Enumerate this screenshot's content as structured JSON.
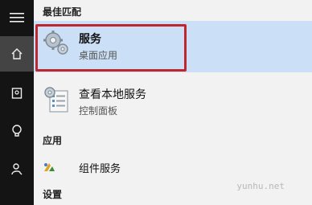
{
  "sections": {
    "best_match": "最佳匹配",
    "apps": "应用",
    "settings": "设置"
  },
  "results": [
    {
      "title": "服务",
      "subtitle": "桌面应用",
      "icon": "services-gear-icon"
    },
    {
      "title": "查看本地服务",
      "subtitle": "控制面板",
      "icon": "control-panel-services-icon"
    }
  ],
  "apps": [
    {
      "label": "组件服务",
      "icon": "component-services-icon"
    }
  ],
  "sidebar": [
    {
      "icon": "hamburger-menu-icon"
    },
    {
      "icon": "home-icon",
      "active": true
    },
    {
      "icon": "notebook-icon"
    },
    {
      "icon": "lightbulb-icon"
    },
    {
      "icon": "feedback-icon"
    }
  ],
  "watermark": "yunhu.net",
  "colors": {
    "selection": "#cbe0f6",
    "highlight_border": "#c0262d",
    "sidebar_bg": "#141414"
  }
}
